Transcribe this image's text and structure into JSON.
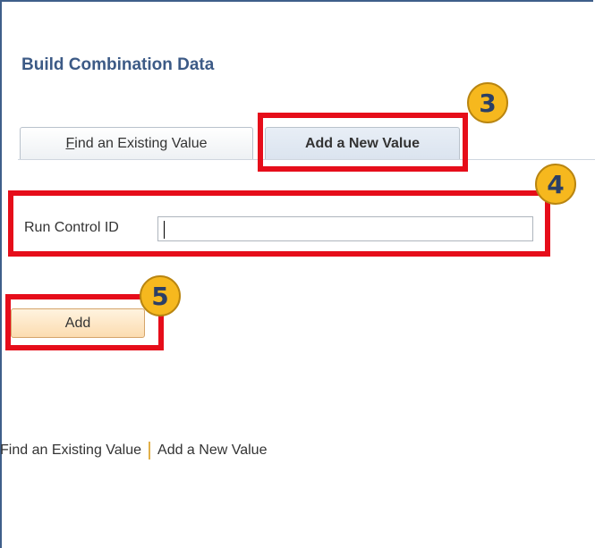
{
  "page": {
    "title": "Build Combination Data"
  },
  "tabs": [
    {
      "mnemonic": "F",
      "label_rest": "ind an Existing Value"
    },
    {
      "label": "Add a New Value"
    }
  ],
  "form": {
    "run_control_label": "Run Control ID",
    "run_control_value": ""
  },
  "actions": {
    "add_label": "Add"
  },
  "footer_links": [
    {
      "label": "Find an Existing Value"
    },
    {
      "label": "Add a New Value"
    }
  ],
  "callouts": [
    "3",
    "4",
    "5"
  ],
  "colors": {
    "title": "#3c5a86",
    "highlight": "#e60d1a",
    "callout": "#f6b81e",
    "button": "#fcdcb0"
  }
}
